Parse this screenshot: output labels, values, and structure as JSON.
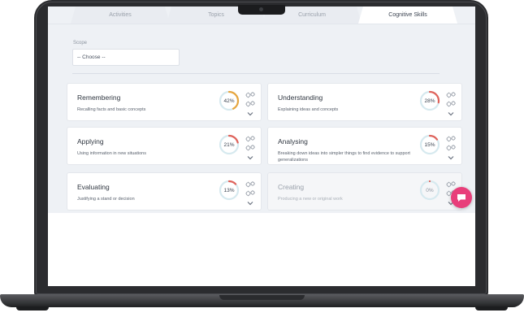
{
  "tabs": [
    {
      "label": "Activities",
      "active": false
    },
    {
      "label": "Topics",
      "active": false
    },
    {
      "label": "Curriculum",
      "active": false
    },
    {
      "label": "Cognitive Skills",
      "active": true
    }
  ],
  "scope": {
    "label": "Scope",
    "value": "-- Choose --"
  },
  "skills": [
    {
      "title": "Remembering",
      "description": "Recalling facts and basic concepts",
      "percent": 42,
      "percent_label": "42%",
      "ring_color": "#e7a53c"
    },
    {
      "title": "Understanding",
      "description": "Explaining ideas and concepts",
      "percent": 28,
      "percent_label": "28%",
      "ring_color": "#e0625a"
    },
    {
      "title": "Applying",
      "description": "Using information in new situations",
      "percent": 21,
      "percent_label": "21%",
      "ring_color": "#e0625a"
    },
    {
      "title": "Analysing",
      "description": "Breaking down ideas into simpler things to find evidence to support generalizations",
      "percent": 15,
      "percent_label": "15%",
      "ring_color": "#e0625a"
    },
    {
      "title": "Evaluating",
      "description": "Justifying a stand or decision",
      "percent": 13,
      "percent_label": "13%",
      "ring_color": "#e0625a"
    },
    {
      "title": "Creating",
      "description": "Producing a new or original work",
      "percent": 0,
      "percent_label": "0%",
      "ring_color": "#e0625a"
    }
  ],
  "colors": {
    "ring_track": "#d6e9ef",
    "chat_button": "#e83e7a"
  },
  "icons": {
    "gears": "gears-icon",
    "expand": "chevron-down-icon",
    "chat": "chat-icon"
  }
}
